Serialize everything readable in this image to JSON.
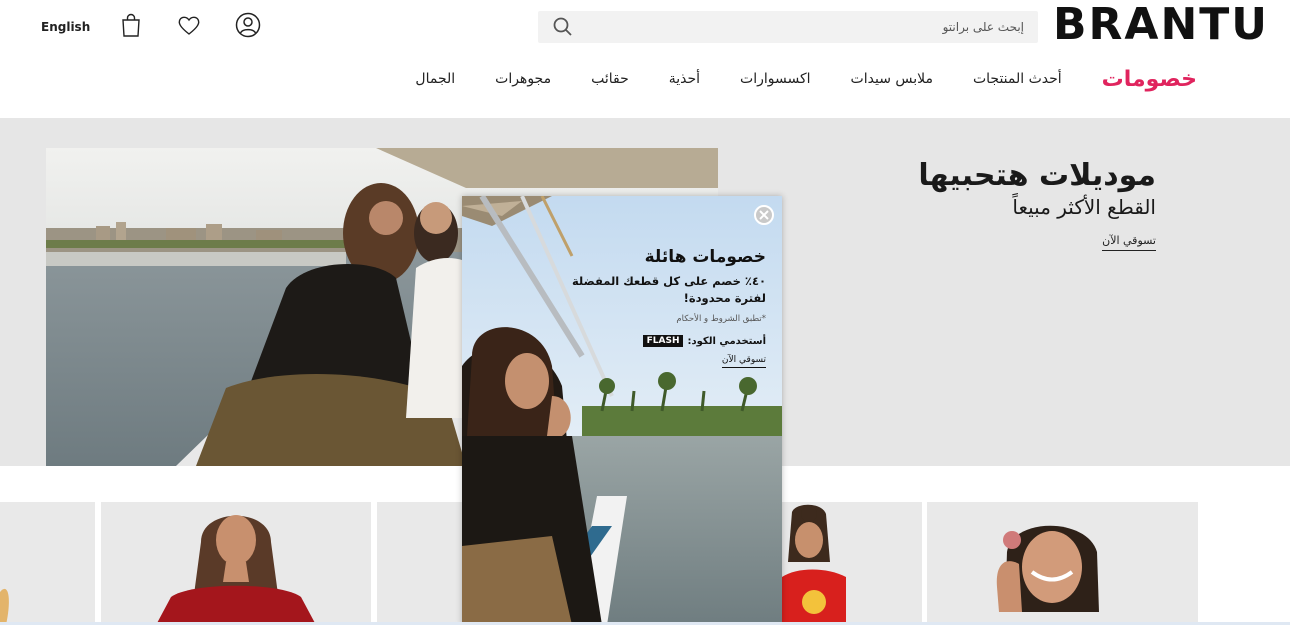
{
  "header": {
    "language_label": "English",
    "logo_text": "BRANTU",
    "search": {
      "placeholder": "إبحث على برانتو",
      "value": ""
    },
    "icons": [
      "bag-icon",
      "heart-icon",
      "user-icon",
      "search-icon"
    ]
  },
  "nav": {
    "items": [
      {
        "label": "خصومات",
        "highlight": true
      },
      {
        "label": "أحدث المنتجات"
      },
      {
        "label": "ملابس سيدات"
      },
      {
        "label": "اكسسوارات"
      },
      {
        "label": "أحذية"
      },
      {
        "label": "حقائب"
      },
      {
        "label": "مجوهرات"
      },
      {
        "label": "الجمال"
      }
    ]
  },
  "hero": {
    "title": "موديلات هتحبيها",
    "subtitle": "القطع الأكثر مبيعاً",
    "cta": "تسوقي الآن"
  },
  "popup": {
    "title": "خصومات هائلة",
    "offer_line1": "٤٠٪ خصم على كل قطعك المفضلة",
    "offer_line2": "لفترة محدودة!",
    "terms": "*تطبق الشروط و الأحكام",
    "code_label": "أستخدمي الكود:",
    "code": "FLASH",
    "cta": "تسوقي الآن"
  },
  "colors": {
    "accent": "#e0245e",
    "hero_bg": "#e6e6e6",
    "text": "#222222"
  }
}
